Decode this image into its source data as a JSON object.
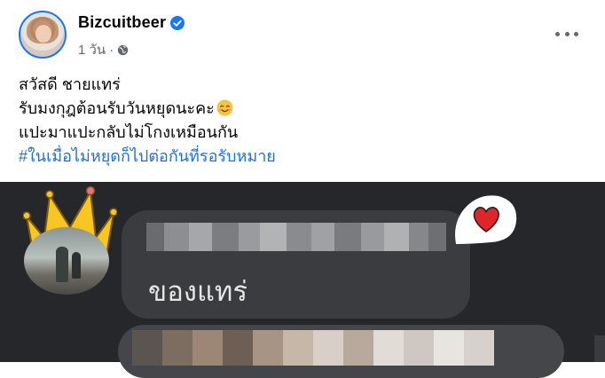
{
  "header": {
    "author_name": "Bizcuitbeer",
    "timestamp": "1 วัน",
    "separator": "·",
    "verified": true,
    "privacy_icon": "globe-icon",
    "more_icon": "more-horizontal-icon",
    "verified_color": "#1877f2"
  },
  "post": {
    "lines": [
      "สวัสดี ชายแทร่",
      "รับมงกุฎต้อนรับวันหยุดนะคะ",
      "แปะมาแปะกลับไม่โกงเหมือนกัน"
    ],
    "emoji_icon": "smiling-face-icon",
    "hashtag": "#ในเมื่อไม่หยุดก็ไปต่อกันที่รอรับหมาย",
    "hashtag_color": "#216fdb"
  },
  "photo": {
    "comment_text": "ของแทร่",
    "background_color": "#26272a",
    "bubble_color": "#3b3c40",
    "icons": [
      "crown-icon",
      "heart-icon"
    ]
  }
}
